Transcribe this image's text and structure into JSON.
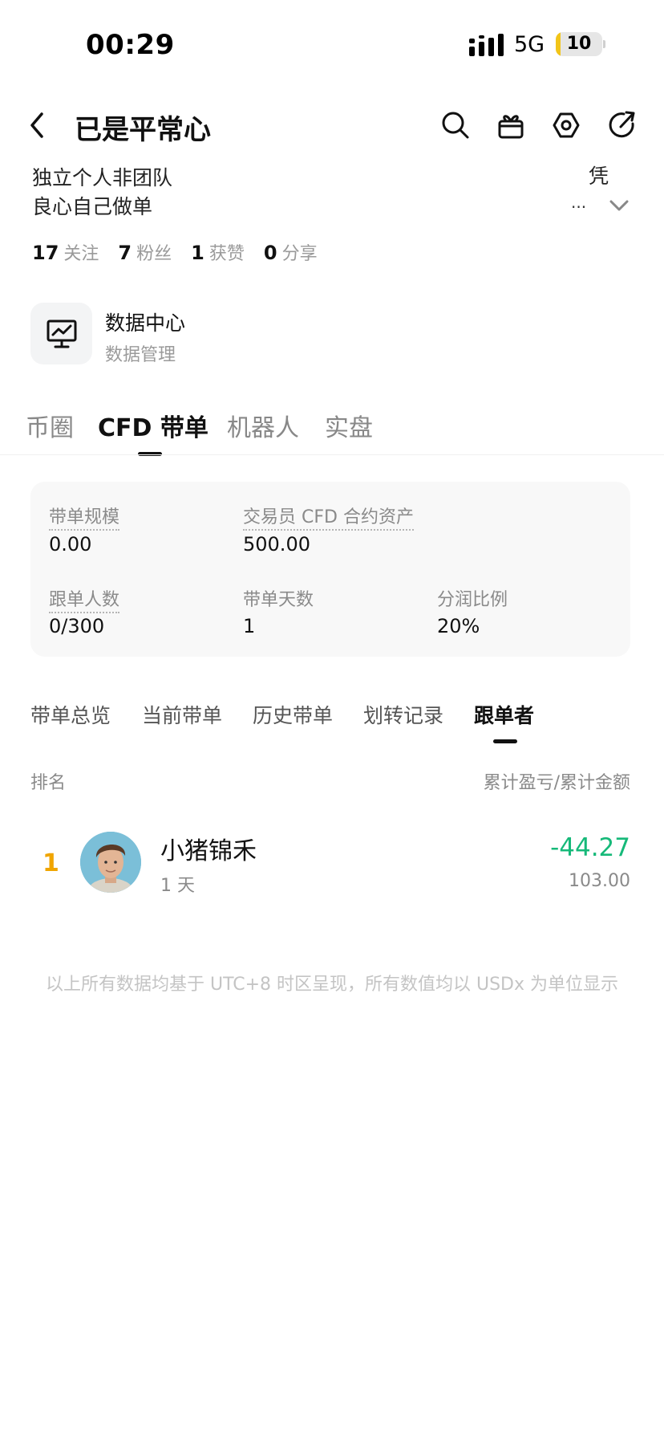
{
  "status_bar": {
    "time": "00:29",
    "network": "5G",
    "battery": "10",
    "battery_level": 0.1
  },
  "header": {
    "title": "已是平常心"
  },
  "profile": {
    "bio_line1": "独立个人非团队",
    "bio_line2": "良心自己做单",
    "side_char": "凭",
    "ellipsis": "...",
    "stats": [
      {
        "count": "17",
        "label": "关注"
      },
      {
        "count": "7",
        "label": "粉丝"
      },
      {
        "count": "1",
        "label": "获赞"
      },
      {
        "count": "0",
        "label": "分享"
      }
    ]
  },
  "data_center": {
    "title": "数据中心",
    "subtitle": "数据管理"
  },
  "main_tabs": [
    {
      "label": "币圈"
    },
    {
      "label": "CFD 带单"
    },
    {
      "label": "机器人"
    },
    {
      "label": "实盘"
    }
  ],
  "summary": {
    "scale_label": "带单规模",
    "scale_value": "0.00",
    "assets_label": "交易员 CFD 合约资产",
    "assets_value": "500.00",
    "followers_label": "跟单人数",
    "followers_value": "0/300",
    "days_label": "带单天数",
    "days_value": "1",
    "share_label": "分润比例",
    "share_value": "20%"
  },
  "sub_tabs": [
    {
      "label": "带单总览"
    },
    {
      "label": "当前带单"
    },
    {
      "label": "历史带单"
    },
    {
      "label": "划转记录"
    },
    {
      "label": "跟单者"
    }
  ],
  "table": {
    "header_left": "排名",
    "header_right": "累计盈亏/累计金额",
    "rows": [
      {
        "rank": "1",
        "name": "小猪锦禾",
        "days": "1 天",
        "pnl": "-44.27",
        "amount": "103.00"
      }
    ]
  },
  "footnote": "以上所有数据均基于 UTC+8 时区呈现，所有数值均以 USDx 为单位显示",
  "colors": {
    "positive_green": "#16b979",
    "rank_gold": "#f0a500",
    "battery_yellow": "#f2c519"
  }
}
